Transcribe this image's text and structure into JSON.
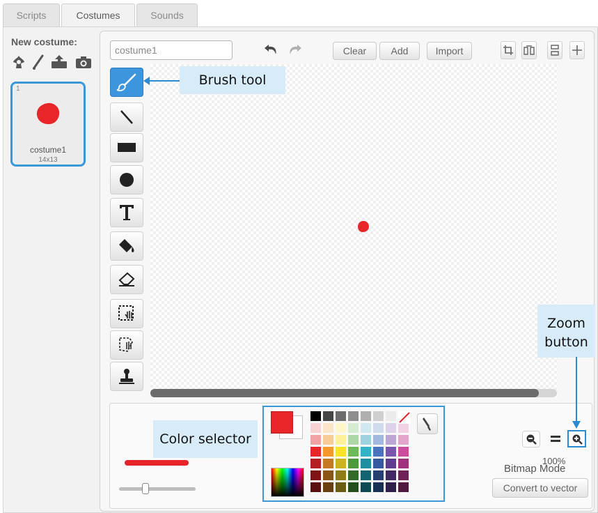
{
  "tabs": [
    {
      "label": "Scripts"
    },
    {
      "label": "Costumes"
    },
    {
      "label": "Sounds"
    }
  ],
  "new_costume": {
    "label": "New costume:",
    "icons": [
      "choose-from-library-icon",
      "paint-brush-icon",
      "upload-icon",
      "camera-icon"
    ]
  },
  "costumes": [
    {
      "number": "1",
      "name": "costume1",
      "size": "14x13",
      "color": "#e8262a"
    }
  ],
  "editor": {
    "costume_name_value": "costume1",
    "undo_icon": "undo-icon",
    "redo_icon": "redo-icon",
    "buttons": {
      "clear": "Clear",
      "add": "Add",
      "import": "Import"
    },
    "transform_icons": [
      "crop-icon",
      "flip-horizontal-icon",
      "flip-vertical-icon",
      "set-center-icon"
    ]
  },
  "tools": [
    "brush-tool-icon",
    "line-tool-icon",
    "rectangle-tool-icon",
    "ellipse-tool-icon",
    "text-tool-icon",
    "fill-tool-icon",
    "eraser-tool-icon",
    "select-tool-icon",
    "select-and-duplicate-tool-icon",
    "stamp-tool-icon"
  ],
  "selected_tool": "brush-tool-icon",
  "callouts": {
    "brush_tool": "Brush tool",
    "color_selector": "Color selector",
    "zoom_button_line1": "Zoom",
    "zoom_button_line2": "button"
  },
  "bottom": {
    "zoom_level": "100%",
    "mode_label": "Bitmap Mode",
    "convert_button": "Convert to vector",
    "primary_color": "#e8262a",
    "secondary_color": "#ffffff",
    "brush_size_level": 0.25
  },
  "palette": [
    [
      "#000000",
      "#464646",
      "#6c6c6c",
      "#8d8d8d",
      "#afafaf",
      "#cfcfcf",
      "#ebebeb",
      "#ffffff"
    ],
    [
      "#f7d1d3",
      "#fbe5c8",
      "#fff7c8",
      "#d6ecd2",
      "#cfe9ef",
      "#d1dbee",
      "#dcd2e9",
      "#f0d2e4"
    ],
    [
      "#f1a2a4",
      "#f8cc96",
      "#fff09a",
      "#aed7a6",
      "#9dd3df",
      "#a3b8dd",
      "#bba6d4",
      "#e2a6ca"
    ],
    [
      "#e8262a",
      "#f39a2a",
      "#fbe32a",
      "#6dba59",
      "#33b3c6",
      "#4b74c0",
      "#7b56ae",
      "#cb4d9c"
    ],
    [
      "#b51f22",
      "#c47a22",
      "#cbb322",
      "#4d9a3d",
      "#1f8f9f",
      "#365a9f",
      "#5e3d8f",
      "#a0327b"
    ],
    [
      "#7d1517",
      "#8a5517",
      "#8e7c17",
      "#336a28",
      "#146370",
      "#243f70",
      "#412a64",
      "#6f2255"
    ],
    [
      "#5a0f11",
      "#6a4011",
      "#6a5d11",
      "#25501d",
      "#0e4a54",
      "#1a2f54",
      "#301f4b",
      "#521940"
    ]
  ]
}
